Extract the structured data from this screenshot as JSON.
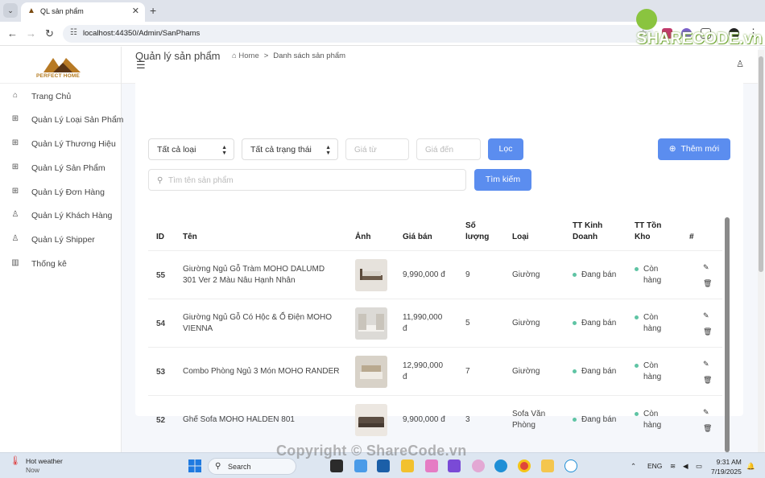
{
  "browser": {
    "tab_title": "QL sản phẩm",
    "url": "localhost:44350/Admin/SanPhams",
    "watermark": "SHARECODE.vn"
  },
  "brand": {
    "logo_text": "PERFECT HOME"
  },
  "sidebar": {
    "items": [
      {
        "label": "Trang Chủ",
        "icon": "home-icon"
      },
      {
        "label": "Quản Lý Loại Sản Phẩm",
        "icon": "grid-icon"
      },
      {
        "label": "Quản Lý Thương Hiệu",
        "icon": "grid-icon"
      },
      {
        "label": "Quản Lý Sản Phẩm",
        "icon": "grid-icon"
      },
      {
        "label": "Quản Lý Đơn Hàng",
        "icon": "grid-icon"
      },
      {
        "label": "Quản Lý Khách Hàng",
        "icon": "user-icon"
      },
      {
        "label": "Quản Lý Shipper",
        "icon": "user-icon"
      },
      {
        "label": "Thống kê",
        "icon": "chart-icon"
      }
    ]
  },
  "page": {
    "title": "Quản lý sản phẩm",
    "breadcrumb_home": "Home",
    "breadcrumb_current": "Danh sách sản phẩm"
  },
  "filters": {
    "category_select": "Tất cả loại",
    "status_select": "Tất cả trạng thái",
    "price_from_placeholder": "Giá từ",
    "price_to_placeholder": "Giá đến",
    "filter_button": "Lọc",
    "add_button": "Thêm mới",
    "search_placeholder": "Tìm tên sản phẩm",
    "search_button": "Tìm kiếm"
  },
  "table": {
    "headers": {
      "id": "ID",
      "name": "Tên",
      "image": "Ảnh",
      "price": "Giá bán",
      "qty_1": "Số",
      "qty_2": "lượng",
      "category": "Loại",
      "business_1": "TT Kinh",
      "business_2": "Doanh",
      "stock_1": "TT Tồn",
      "stock_2": "Kho",
      "actions": "#"
    },
    "rows": [
      {
        "id": "55",
        "name_1": "Giường Ngủ Gỗ Tràm MOHO DALUMD",
        "name_2": "301 Ver 2 Màu Nâu Hạnh Nhân",
        "price_1": "9,990,000 đ",
        "price_2": "",
        "qty": "9",
        "cat_1": "Giường",
        "cat_2": "",
        "business": "Đang bán",
        "stock_1": "Còn",
        "stock_2": "hàng"
      },
      {
        "id": "54",
        "name_1": "Giường Ngủ Gỗ Có Hộc & Ổ Điện MOHO",
        "name_2": "VIENNA",
        "price_1": "11,990,000",
        "price_2": "đ",
        "qty": "5",
        "cat_1": "Giường",
        "cat_2": "",
        "business": "Đang bán",
        "stock_1": "Còn",
        "stock_2": "hàng"
      },
      {
        "id": "53",
        "name_1": "Combo Phòng Ngủ 3 Món MOHO RANDER",
        "name_2": "",
        "price_1": "12,990,000",
        "price_2": "đ",
        "qty": "7",
        "cat_1": "Giường",
        "cat_2": "",
        "business": "Đang bán",
        "stock_1": "Còn",
        "stock_2": "hàng"
      },
      {
        "id": "52",
        "name_1": "Ghế Sofa MOHO HALDEN 801",
        "name_2": "",
        "price_1": "9,900,000 đ",
        "price_2": "",
        "qty": "3",
        "cat_1": "Sofa Văn",
        "cat_2": "Phòng",
        "business": "Đang bán",
        "stock_1": "Còn",
        "stock_2": "hàng"
      }
    ]
  },
  "taskbar": {
    "weather_title": "Hot weather",
    "weather_sub": "Now",
    "search_label": "Search",
    "lang": "ENG",
    "time": "9:31 AM",
    "date": "7/19/2025",
    "copyright": "Copyright © ShareCode.vn"
  },
  "colors": {
    "primary": "#5b8def",
    "status_dot": "#5fc4a4"
  }
}
